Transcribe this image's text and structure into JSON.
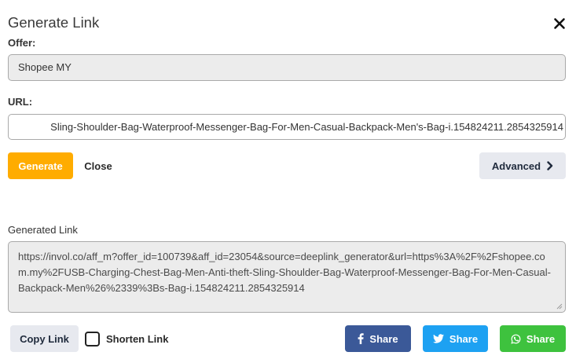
{
  "dialog": {
    "title": "Generate Link",
    "close_icon": "close-icon"
  },
  "offer": {
    "label": "Offer:",
    "value": "Shopee MY"
  },
  "url": {
    "label": "URL:",
    "value": "Sling-Shoulder-Bag-Waterproof-Messenger-Bag-For-Men-Casual-Backpack-Men's-Bag-i.154824211.2854325914"
  },
  "actions": {
    "generate_label": "Generate",
    "close_label": "Close",
    "advanced_label": "Advanced",
    "advanced_icon": "chevron-right-icon"
  },
  "generated": {
    "label": "Generated Link",
    "value": "https://invol.co/aff_m?offer_id=100739&aff_id=23054&source=deeplink_generator&url=https%3A%2F%2Fshopee.com.my%2FUSB-Charging-Chest-Bag-Men-Anti-theft-Sling-Shoulder-Bag-Waterproof-Messenger-Bag-For-Men-Casual-Backpack-Men%26%2339%3Bs-Bag-i.154824211.2854325914"
  },
  "footer": {
    "copy_label": "Copy Link",
    "shorten_label": "Shorten Link",
    "shorten_checked": false,
    "share_facebook_label": "Share",
    "share_twitter_label": "Share",
    "share_whatsapp_label": "Share"
  },
  "colors": {
    "generate": "#ffac00",
    "facebook": "#3b5998",
    "twitter": "#1da1f2",
    "whatsapp": "#3ec23e",
    "secondary_button": "#e7e9ef"
  }
}
